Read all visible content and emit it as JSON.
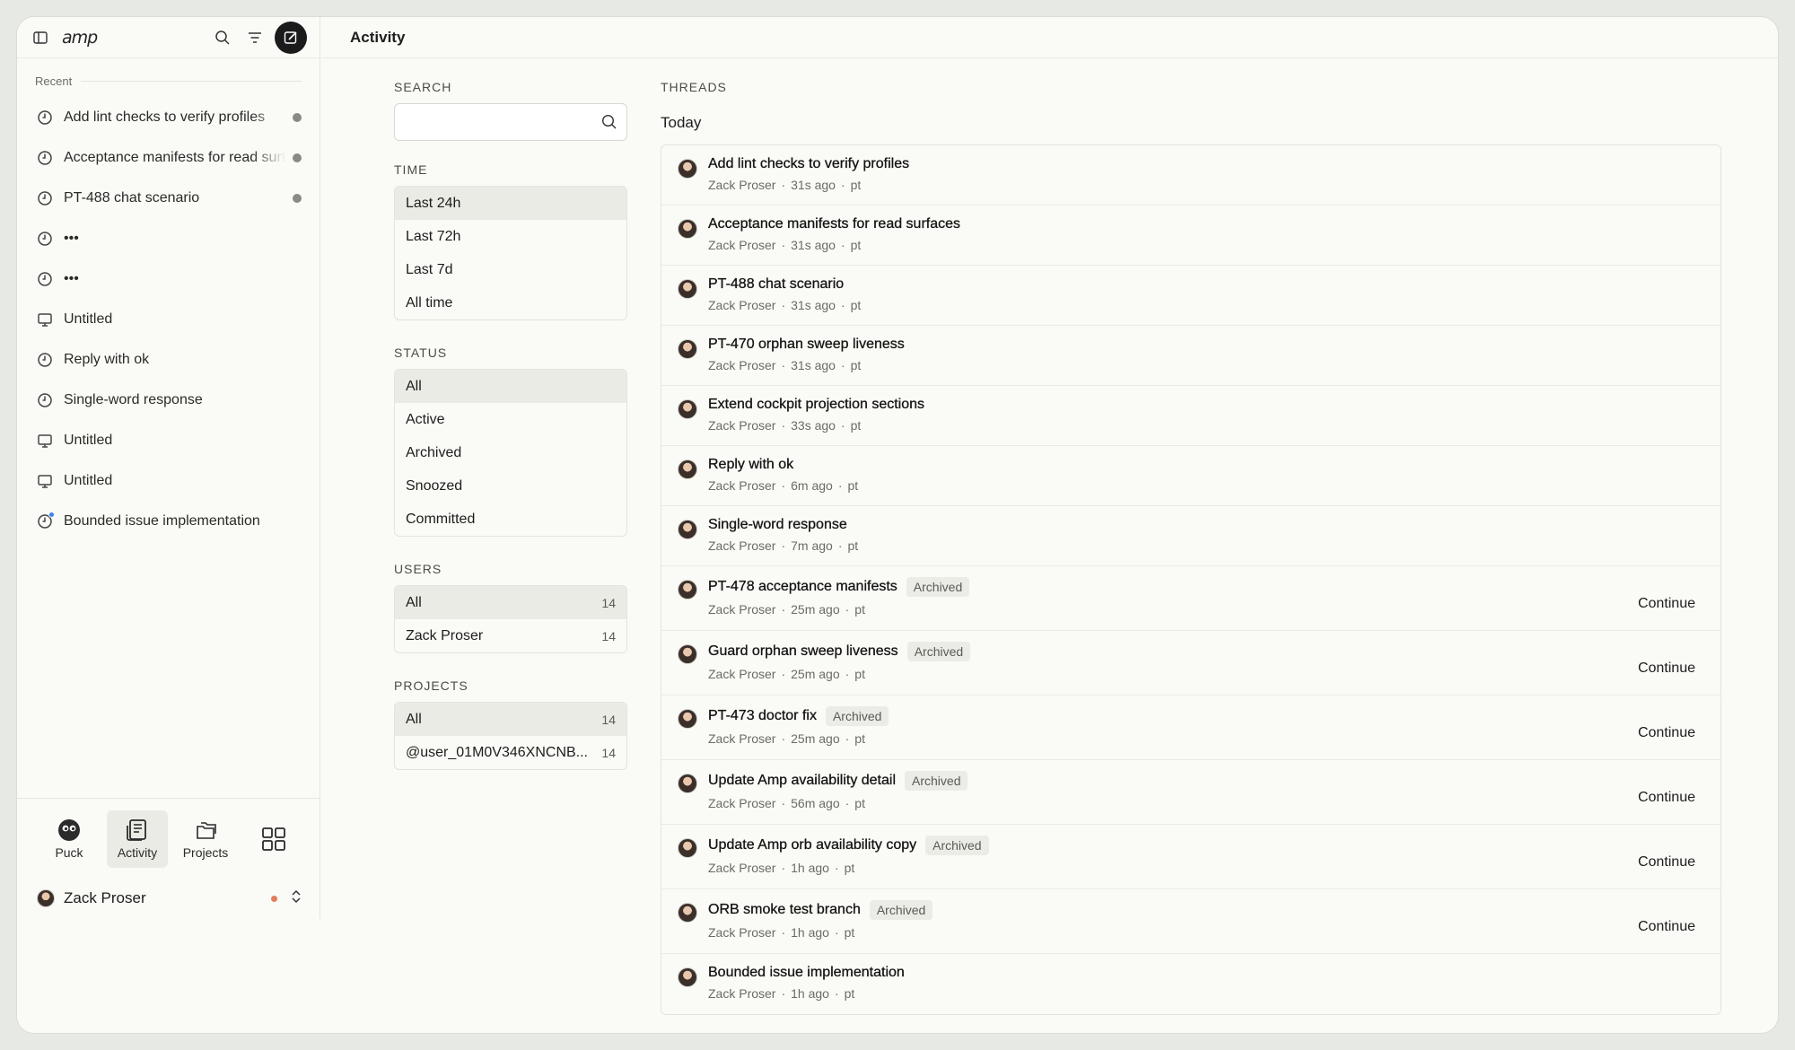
{
  "app": {
    "logo": "amp",
    "page_title": "Activity"
  },
  "sidebar": {
    "recent_label": "Recent",
    "items": [
      {
        "label": "Add lint checks to verify profiles",
        "icon": "clock-icon",
        "dot": true
      },
      {
        "label": "Acceptance manifests for read surfaces",
        "icon": "clock-icon",
        "dot": true
      },
      {
        "label": "PT-488 chat scenario",
        "icon": "clock-icon",
        "dot": true
      },
      {
        "label": "•••",
        "icon": "clock-icon",
        "dot": false
      },
      {
        "label": "•••",
        "icon": "clock-icon",
        "dot": false
      },
      {
        "label": "Untitled",
        "icon": "monitor-icon",
        "dot": false
      },
      {
        "label": "Reply with ok",
        "icon": "clock-icon",
        "dot": false
      },
      {
        "label": "Single-word response",
        "icon": "clock-icon",
        "dot": false
      },
      {
        "label": "Untitled",
        "icon": "monitor-icon",
        "dot": false
      },
      {
        "label": "Untitled",
        "icon": "monitor-icon",
        "dot": false
      },
      {
        "label": "Bounded issue implementation",
        "icon": "clock-icon",
        "dot": false,
        "badge": true
      }
    ],
    "nav": [
      {
        "label": "Puck",
        "icon": "puck-icon"
      },
      {
        "label": "Activity",
        "icon": "activity-icon",
        "active": true
      },
      {
        "label": "Projects",
        "icon": "folders-icon"
      }
    ],
    "user": {
      "name": "Zack Proser"
    }
  },
  "filters": {
    "search_label": "SEARCH",
    "search_placeholder": "",
    "time_label": "TIME",
    "time": [
      "Last 24h",
      "Last 72h",
      "Last 7d",
      "All time"
    ],
    "status_label": "STATUS",
    "status": [
      "All",
      "Active",
      "Archived",
      "Snoozed",
      "Committed"
    ],
    "users_label": "USERS",
    "users": [
      {
        "label": "All",
        "count": "14"
      },
      {
        "label": "Zack Proser",
        "count": "14"
      }
    ],
    "projects_label": "PROJECTS",
    "projects": [
      {
        "label": "All",
        "count": "14"
      },
      {
        "label": "@user_01M0V346XNCNB...",
        "count": "14"
      }
    ]
  },
  "threads": {
    "label": "THREADS",
    "group": "Today",
    "archived_label": "Archived",
    "continue_label": "Continue",
    "rows": [
      {
        "title": "Add lint checks to verify profiles",
        "user": "Zack Proser",
        "time": "31s ago",
        "tag": "pt",
        "archived": false
      },
      {
        "title": "Acceptance manifests for read surfaces",
        "user": "Zack Proser",
        "time": "31s ago",
        "tag": "pt",
        "archived": false
      },
      {
        "title": "PT-488 chat scenario",
        "user": "Zack Proser",
        "time": "31s ago",
        "tag": "pt",
        "archived": false
      },
      {
        "title": "PT-470 orphan sweep liveness",
        "user": "Zack Proser",
        "time": "31s ago",
        "tag": "pt",
        "archived": false
      },
      {
        "title": "Extend cockpit projection sections",
        "user": "Zack Proser",
        "time": "33s ago",
        "tag": "pt",
        "archived": false
      },
      {
        "title": "Reply with ok",
        "user": "Zack Proser",
        "time": "6m ago",
        "tag": "pt",
        "archived": false
      },
      {
        "title": "Single-word response",
        "user": "Zack Proser",
        "time": "7m ago",
        "tag": "pt",
        "archived": false
      },
      {
        "title": "PT-478 acceptance manifests",
        "user": "Zack Proser",
        "time": "25m ago",
        "tag": "pt",
        "archived": true
      },
      {
        "title": "Guard orphan sweep liveness",
        "user": "Zack Proser",
        "time": "25m ago",
        "tag": "pt",
        "archived": true
      },
      {
        "title": "PT-473 doctor fix",
        "user": "Zack Proser",
        "time": "25m ago",
        "tag": "pt",
        "archived": true
      },
      {
        "title": "Update Amp availability detail",
        "user": "Zack Proser",
        "time": "56m ago",
        "tag": "pt",
        "archived": true
      },
      {
        "title": "Update Amp orb availability copy",
        "user": "Zack Proser",
        "time": "1h ago",
        "tag": "pt",
        "archived": true
      },
      {
        "title": "ORB smoke test branch",
        "user": "Zack Proser",
        "time": "1h ago",
        "tag": "pt",
        "archived": true
      },
      {
        "title": "Bounded issue implementation",
        "user": "Zack Proser",
        "time": "1h ago",
        "tag": "pt",
        "archived": false
      }
    ]
  }
}
